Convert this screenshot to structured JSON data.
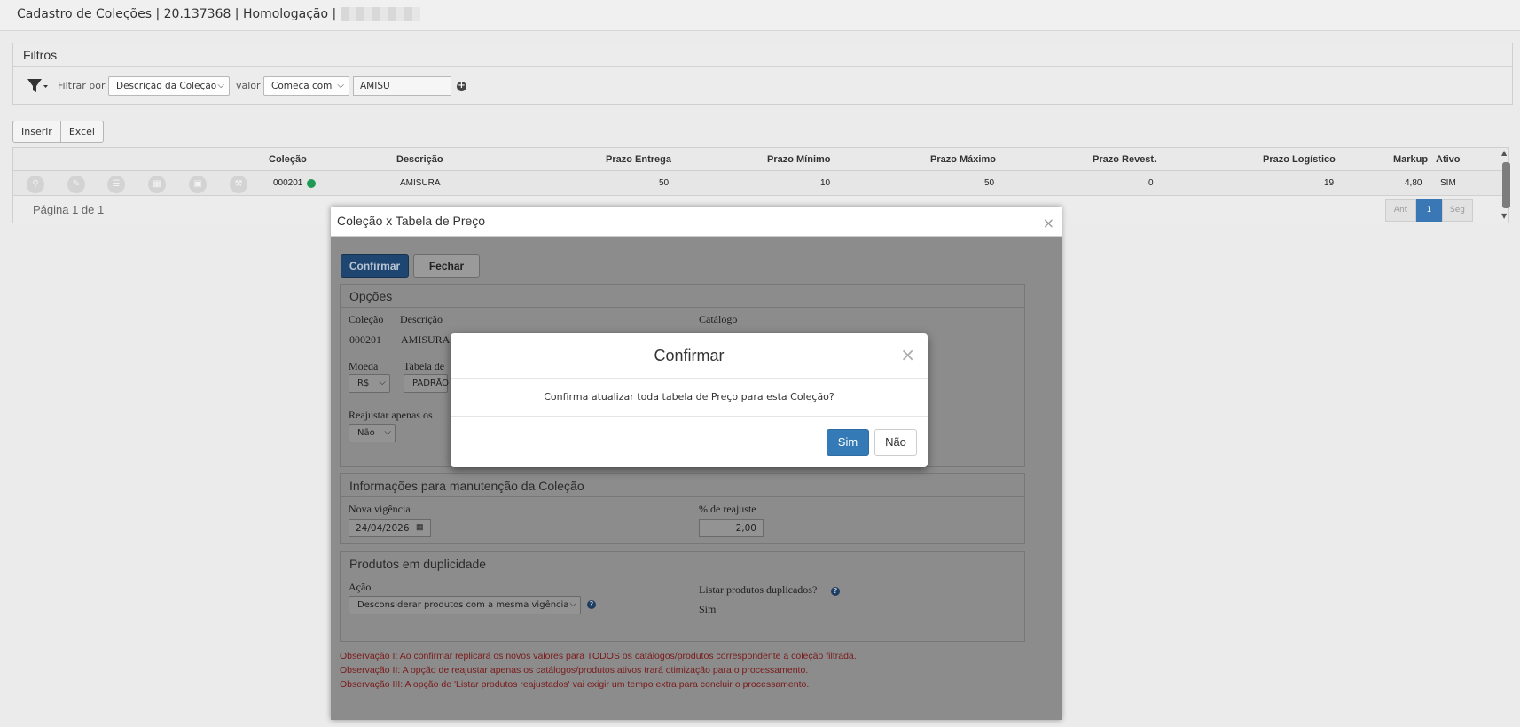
{
  "titlebar": {
    "title": "Cadastro de Coleções | 20.137368 | Homologação |"
  },
  "filters": {
    "header": "Filtros",
    "filter_by_label": "Filtrar por",
    "filter_by_value": "Descrição da Coleção",
    "value_label": "valor",
    "operator_value": "Começa com",
    "search_value": "AMISU"
  },
  "toolbar": {
    "insert": "Inserir",
    "excel": "Excel"
  },
  "grid": {
    "columns": [
      "Coleção",
      "Descrição",
      "Prazo Entrega",
      "Prazo Mínimo",
      "Prazo Máximo",
      "Prazo Revest.",
      "Prazo Logístico",
      "Markup",
      "Ativo"
    ],
    "row": {
      "colecao": "000201",
      "status_color": "#1f9a55",
      "descricao": "AMISURA",
      "prazo_entrega": "50",
      "prazo_minimo": "10",
      "prazo_maximo": "50",
      "prazo_revest": "0",
      "prazo_logistico": "19",
      "markup": "4,80",
      "ativo": "SIM"
    },
    "row_icons": [
      "search-icon",
      "pencil-icon",
      "list-icon",
      "table-icon",
      "money-icon",
      "wrench-icon"
    ],
    "page_info": "Página 1 de 1",
    "pager": {
      "prev": "Ant",
      "current": "1",
      "next": "Seg"
    }
  },
  "modal_tabela": {
    "title": "Coleção x Tabela de Preço",
    "confirm_btn": "Confirmar",
    "close_btn": "Fechar",
    "opcoes": {
      "header": "Opções",
      "colecao_label": "Coleção",
      "colecao_value": "000201",
      "descricao_label": "Descrição",
      "descricao_value": "AMISURA",
      "catalogo_label": "Catálogo",
      "moeda_label": "Moeda",
      "moeda_value": "R$",
      "tabela_label": "Tabela de",
      "tabela_value": "PADRÃO",
      "reajustar_label": "Reajustar apenas os",
      "reajustar_value": "Não"
    },
    "manutencao": {
      "header": "Informações para manutenção da Coleção",
      "vigencia_label": "Nova vigência",
      "vigencia_value": "24/04/2026",
      "reajuste_label": "% de reajuste",
      "reajuste_value": "2,00"
    },
    "duplicidade": {
      "header": "Produtos em duplicidade",
      "acao_label": "Ação",
      "acao_value": "Desconsiderar produtos com a mesma vigência",
      "listar_label": "Listar produtos duplicados?",
      "listar_value": "Sim"
    },
    "observacoes": [
      "Observação I: Ao confirmar replicará os novos valores para TODOS os catálogos/produtos correspondente a coleção filtrada.",
      "Observação II: A opção de reajustar apenas os catálogos/produtos ativos trará otimização para o processamento.",
      "Observação III: A opção de 'Listar produtos reajustados' vai exigir um tempo extra para concluir o processamento."
    ]
  },
  "modal_confirmar": {
    "title": "Confirmar",
    "message": "Confirma atualizar toda tabela de Preço para esta Coleção?",
    "yes": "Sim",
    "no": "Não"
  }
}
